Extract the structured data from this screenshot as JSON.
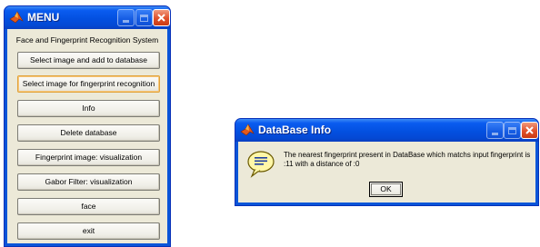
{
  "colors": {
    "titlebar_blue": "#0350e0",
    "client_background": "#ece9d8",
    "close_button_red": "#e0502a",
    "focus_orange": "#e0a23a"
  },
  "menu_window": {
    "title": "MENU",
    "icon": "matlab-logo-icon",
    "heading": "Face and Fingerprint Recognition System",
    "buttons": [
      {
        "label": "Select image and add to database"
      },
      {
        "label": "Select image for fingerprint recognition"
      },
      {
        "label": "Info"
      },
      {
        "label": "Delete database"
      },
      {
        "label": "Fingerprint image: visualization"
      },
      {
        "label": "Gabor Filter: visualization"
      },
      {
        "label": "face"
      },
      {
        "label": "exit"
      }
    ],
    "title_controls": [
      "minimize-icon",
      "maximize-icon",
      "close-icon"
    ]
  },
  "info_dialog": {
    "title": "DataBase Info",
    "icon": "help-speech-bubble-icon",
    "message": "The nearest fingerprint present in DataBase which matchs input fingerprint is :11 with a distance of :0",
    "ok_label": "OK",
    "title_controls": [
      "minimize-icon",
      "maximize-icon",
      "close-icon"
    ]
  }
}
